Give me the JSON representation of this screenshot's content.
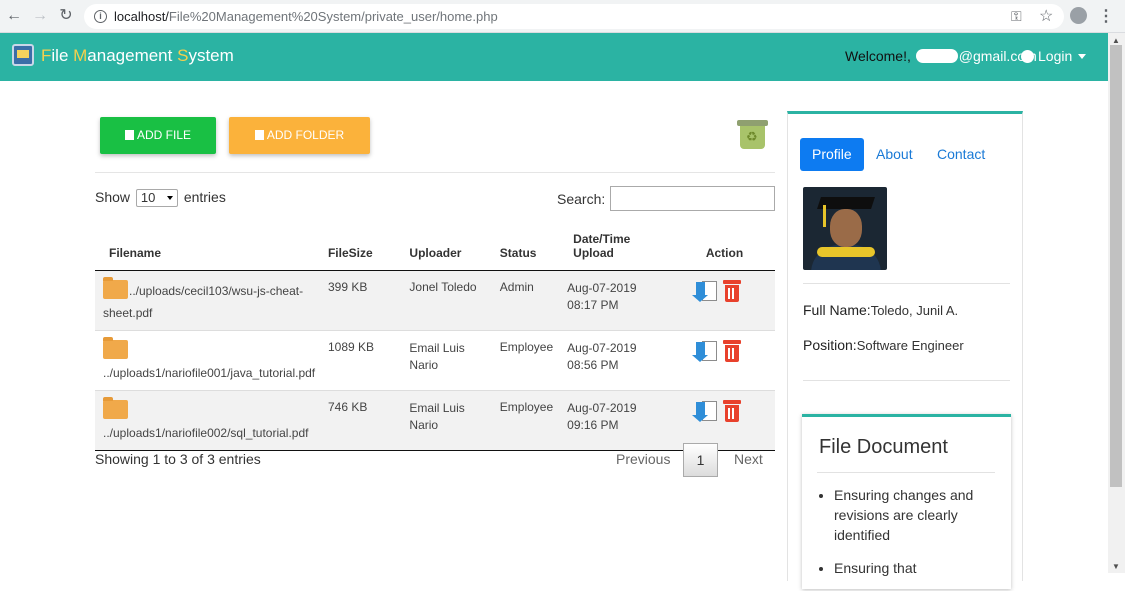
{
  "browser": {
    "url_host": "localhost/",
    "url_path": "File%20Management%20System/private_user/home.php"
  },
  "navbar": {
    "brand_parts": [
      "F",
      "ile ",
      "M",
      "anagement ",
      "S",
      "ystem"
    ],
    "welcome_label": "Welcome!,",
    "email_suffix": "@gmail.com",
    "login_label": "Login"
  },
  "toolbar": {
    "add_file_label": "ADD FILE",
    "add_folder_label": "ADD FOLDER"
  },
  "table_controls": {
    "show_label": "Show",
    "entries_value": "10",
    "entries_label": "entries",
    "search_label": "Search:",
    "search_value": ""
  },
  "table": {
    "headers": [
      "Filename",
      "FileSize",
      "Uploader",
      "Status",
      "Date/Time Upload",
      "Action"
    ],
    "rows": [
      {
        "filename": "../uploads/cecil103/wsu-js-cheat-sheet.pdf",
        "size": "399 KB",
        "uploader": "Jonel Toledo",
        "status": "Admin",
        "date": "Aug-07-2019",
        "time": "08:17 PM"
      },
      {
        "filename": "../uploads1/nariofile001/java_tutorial.pdf",
        "size": "1089 KB",
        "uploader": "Email Luis Nario",
        "status": "Employee",
        "date": "Aug-07-2019",
        "time": "08:56 PM"
      },
      {
        "filename": "../uploads1/nariofile002/sql_tutorial.pdf",
        "size": "746 KB",
        "uploader": "Email Luis Nario",
        "status": "Employee",
        "date": "Aug-07-2019",
        "time": "09:16 PM"
      }
    ]
  },
  "pagination": {
    "info": "Showing 1 to 3 of 3 entries",
    "previous_label": "Previous",
    "current_page": "1",
    "next_label": "Next"
  },
  "profile": {
    "tabs": [
      "Profile",
      "About",
      "Contact"
    ],
    "full_name_label": "Full Name:",
    "full_name": "Toledo, Junil A.",
    "position_label": "Position:",
    "position": "Software Engineer"
  },
  "file_document": {
    "title": "File Document",
    "items": [
      "Ensuring changes and revisions are clearly identified",
      "Ensuring that"
    ]
  },
  "colors": {
    "navbar": "#2bb3a3",
    "add_file": "#19c044",
    "add_folder": "#fbb23b",
    "active_tab": "#0d7bf1",
    "delete": "#e8412c"
  }
}
